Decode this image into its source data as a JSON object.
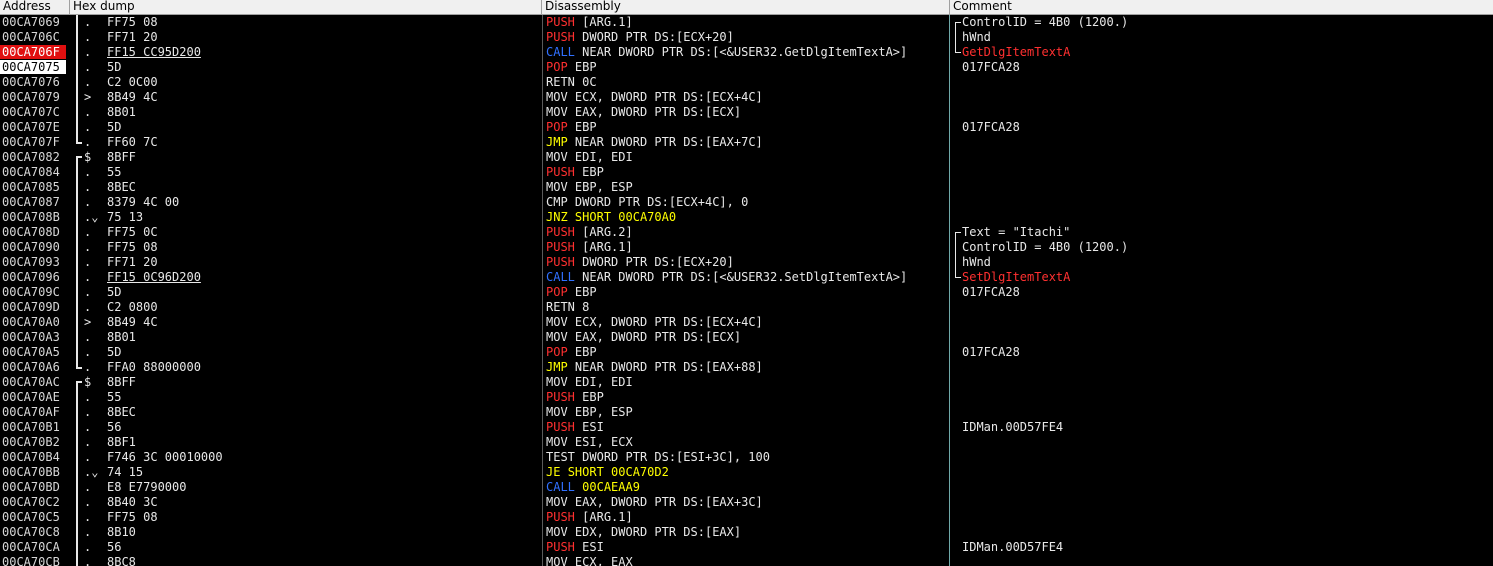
{
  "columns": {
    "address": "Address",
    "hex": "Hex dump",
    "disassembly": "Disassembly",
    "comment": "Comment"
  },
  "colors": {
    "background": "#000000",
    "breakpoint": "#e01010",
    "current": "#ffffff",
    "push_pop": "#ff3030",
    "call": "#3070ff",
    "jump": "#ffff00"
  },
  "rows": [
    {
      "addr": "00CA7069",
      "gut": "line",
      "mk": ".",
      "hex": "FF75 08",
      "op": "PUSH",
      "opk": "push",
      "args": "[ARG.1]",
      "cmt": "ControlID = 4B0 (1200.)",
      "cb": "start"
    },
    {
      "addr": "00CA706C",
      "gut": "line",
      "mk": ".",
      "hex": "FF71 20",
      "op": "PUSH",
      "opk": "push",
      "args": "DWORD PTR DS:[ECX+20]",
      "cmt": "hWnd",
      "cb": "mid"
    },
    {
      "addr": "00CA706F",
      "state": "bp",
      "gut": "line",
      "mk": ".",
      "hex": "FF15 CC95D200",
      "hexu": true,
      "op": "CALL",
      "opk": "call",
      "args": "NEAR DWORD PTR DS:[<&USER32.GetDlgItemTextA>]",
      "cmt": "GetDlgItemTextA",
      "cmtred": true,
      "cb": "end"
    },
    {
      "addr": "00CA7075",
      "state": "cur",
      "gut": "line",
      "mk": ".",
      "hex": "5D",
      "op": "POP",
      "opk": "pop",
      "args": "EBP",
      "cmt": "017FCA28"
    },
    {
      "addr": "00CA7076",
      "gut": "line",
      "mk": ".",
      "hex": "C2 0C00",
      "op": "RETN",
      "opk": "",
      "args": "0C",
      "cmt": ""
    },
    {
      "addr": "00CA7079",
      "gut": "line",
      "mk": ">",
      "hex": "8B49 4C",
      "op": "MOV",
      "opk": "",
      "args": "ECX, DWORD PTR DS:[ECX+4C]",
      "cmt": ""
    },
    {
      "addr": "00CA707C",
      "gut": "line",
      "mk": ".",
      "hex": "8B01",
      "op": "MOV",
      "opk": "",
      "args": "EAX, DWORD PTR DS:[ECX]",
      "cmt": ""
    },
    {
      "addr": "00CA707E",
      "gut": "line",
      "mk": ".",
      "hex": "5D",
      "op": "POP",
      "opk": "pop",
      "args": "EBP",
      "cmt": "017FCA28"
    },
    {
      "addr": "00CA707F",
      "gut": "end",
      "mk": ".",
      "hex": "FF60 7C",
      "op": "JMP",
      "opk": "jmp",
      "args": "NEAR DWORD PTR DS:[EAX+7C]",
      "cmt": ""
    },
    {
      "addr": "00CA7082",
      "gut": "start",
      "mk": "$",
      "hex": "8BFF",
      "op": "MOV",
      "opk": "",
      "args": "EDI, EDI",
      "cmt": ""
    },
    {
      "addr": "00CA7084",
      "gut": "line",
      "mk": ".",
      "hex": "55",
      "op": "PUSH",
      "opk": "push",
      "args": "EBP",
      "cmt": ""
    },
    {
      "addr": "00CA7085",
      "gut": "line",
      "mk": ".",
      "hex": "8BEC",
      "op": "MOV",
      "opk": "",
      "args": "EBP, ESP",
      "cmt": ""
    },
    {
      "addr": "00CA7087",
      "gut": "line",
      "mk": ".",
      "hex": "8379 4C 00",
      "op": "CMP",
      "opk": "",
      "args": "DWORD PTR DS:[ECX+4C], 0",
      "cmt": ""
    },
    {
      "addr": "00CA708B",
      "gut": "line",
      "mk": ".⌄",
      "hex": "75 13",
      "op": "JNZ",
      "opk": "jcc",
      "args": "SHORT 00CA70A0",
      "argsy": true,
      "cmt": ""
    },
    {
      "addr": "00CA708D",
      "gut": "line",
      "mk": ".",
      "hex": "FF75 0C",
      "op": "PUSH",
      "opk": "push",
      "args": "[ARG.2]",
      "cmt": "Text = \"Itachi\"",
      "cb": "start"
    },
    {
      "addr": "00CA7090",
      "gut": "line",
      "mk": ".",
      "hex": "FF75 08",
      "op": "PUSH",
      "opk": "push",
      "args": "[ARG.1]",
      "cmt": "ControlID = 4B0 (1200.)",
      "cb": "mid"
    },
    {
      "addr": "00CA7093",
      "gut": "line",
      "mk": ".",
      "hex": "FF71 20",
      "op": "PUSH",
      "opk": "push",
      "args": "DWORD PTR DS:[ECX+20]",
      "cmt": "hWnd",
      "cb": "mid"
    },
    {
      "addr": "00CA7096",
      "gut": "line",
      "mk": ".",
      "hex": "FF15 0C96D200",
      "hexu": true,
      "op": "CALL",
      "opk": "call",
      "args": "NEAR DWORD PTR DS:[<&USER32.SetDlgItemTextA>]",
      "cmt": "SetDlgItemTextA",
      "cmtred": true,
      "cb": "end"
    },
    {
      "addr": "00CA709C",
      "gut": "line",
      "mk": ".",
      "hex": "5D",
      "op": "POP",
      "opk": "pop",
      "args": "EBP",
      "cmt": "017FCA28"
    },
    {
      "addr": "00CA709D",
      "gut": "line",
      "mk": ".",
      "hex": "C2 0800",
      "op": "RETN",
      "opk": "",
      "args": "8",
      "cmt": ""
    },
    {
      "addr": "00CA70A0",
      "gut": "line",
      "mk": ">",
      "hex": "8B49 4C",
      "op": "MOV",
      "opk": "",
      "args": "ECX, DWORD PTR DS:[ECX+4C]",
      "cmt": ""
    },
    {
      "addr": "00CA70A3",
      "gut": "line",
      "mk": ".",
      "hex": "8B01",
      "op": "MOV",
      "opk": "",
      "args": "EAX, DWORD PTR DS:[ECX]",
      "cmt": ""
    },
    {
      "addr": "00CA70A5",
      "gut": "line",
      "mk": ".",
      "hex": "5D",
      "op": "POP",
      "opk": "pop",
      "args": "EBP",
      "cmt": "017FCA28"
    },
    {
      "addr": "00CA70A6",
      "gut": "end",
      "mk": ".",
      "hex": "FFA0 88000000",
      "op": "JMP",
      "opk": "jmp",
      "args": "NEAR DWORD PTR DS:[EAX+88]",
      "cmt": ""
    },
    {
      "addr": "00CA70AC",
      "gut": "start",
      "mk": "$",
      "hex": "8BFF",
      "op": "MOV",
      "opk": "",
      "args": "EDI, EDI",
      "cmt": ""
    },
    {
      "addr": "00CA70AE",
      "gut": "line",
      "mk": ".",
      "hex": "55",
      "op": "PUSH",
      "opk": "push",
      "args": "EBP",
      "cmt": ""
    },
    {
      "addr": "00CA70AF",
      "gut": "line",
      "mk": ".",
      "hex": "8BEC",
      "op": "MOV",
      "opk": "",
      "args": "EBP, ESP",
      "cmt": ""
    },
    {
      "addr": "00CA70B1",
      "gut": "line",
      "mk": ".",
      "hex": "56",
      "op": "PUSH",
      "opk": "push",
      "args": "ESI",
      "cmt": "IDMan.00D57FE4"
    },
    {
      "addr": "00CA70B2",
      "gut": "line",
      "mk": ".",
      "hex": "8BF1",
      "op": "MOV",
      "opk": "",
      "args": "ESI, ECX",
      "cmt": ""
    },
    {
      "addr": "00CA70B4",
      "gut": "line",
      "mk": ".",
      "hex": "F746 3C 00010000",
      "op": "TEST",
      "opk": "",
      "args": "DWORD PTR DS:[ESI+3C], 100",
      "cmt": ""
    },
    {
      "addr": "00CA70BB",
      "gut": "line",
      "mk": ".⌄",
      "hex": "74 15",
      "op": "JE",
      "opk": "jcc",
      "args": "SHORT 00CA70D2",
      "argsy": true,
      "cmt": ""
    },
    {
      "addr": "00CA70BD",
      "gut": "line",
      "mk": ".",
      "hex": "E8 E7790000",
      "op": "CALL",
      "opk": "call",
      "args": "00CAEAA9",
      "argsy": true,
      "cmt": ""
    },
    {
      "addr": "00CA70C2",
      "gut": "line",
      "mk": ".",
      "hex": "8B40 3C",
      "op": "MOV",
      "opk": "",
      "args": "EAX, DWORD PTR DS:[EAX+3C]",
      "cmt": ""
    },
    {
      "addr": "00CA70C5",
      "gut": "line",
      "mk": ".",
      "hex": "FF75 08",
      "op": "PUSH",
      "opk": "push",
      "args": "[ARG.1]",
      "cmt": ""
    },
    {
      "addr": "00CA70C8",
      "gut": "line",
      "mk": ".",
      "hex": "8B10",
      "op": "MOV",
      "opk": "",
      "args": "EDX, DWORD PTR DS:[EAX]",
      "cmt": ""
    },
    {
      "addr": "00CA70CA",
      "gut": "line",
      "mk": ".",
      "hex": "56",
      "op": "PUSH",
      "opk": "push",
      "args": "ESI",
      "cmt": "IDMan.00D57FE4"
    },
    {
      "addr": "00CA70CB",
      "gut": "line",
      "mk": ".",
      "hex": "8BC8",
      "op": "MOV",
      "opk": "",
      "args": "ECX, EAX",
      "cmt": ""
    }
  ]
}
